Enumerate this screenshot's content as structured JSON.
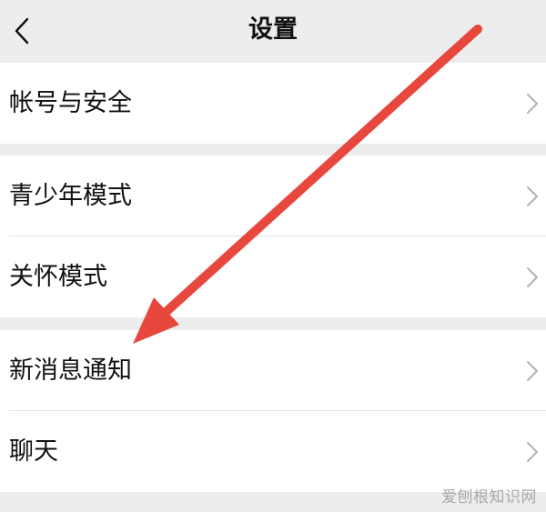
{
  "header": {
    "title": "设置",
    "back_icon": "chevron-left-icon"
  },
  "groups": [
    {
      "items": [
        {
          "label": "帐号与安全"
        }
      ]
    },
    {
      "items": [
        {
          "label": "青少年模式"
        },
        {
          "label": "关怀模式"
        }
      ]
    },
    {
      "items": [
        {
          "label": "新消息通知"
        },
        {
          "label": "聊天"
        }
      ]
    }
  ],
  "annotation": {
    "color": "#e8473d",
    "icon": "red-arrow-annotation"
  },
  "watermark": "爱刨根知识网"
}
